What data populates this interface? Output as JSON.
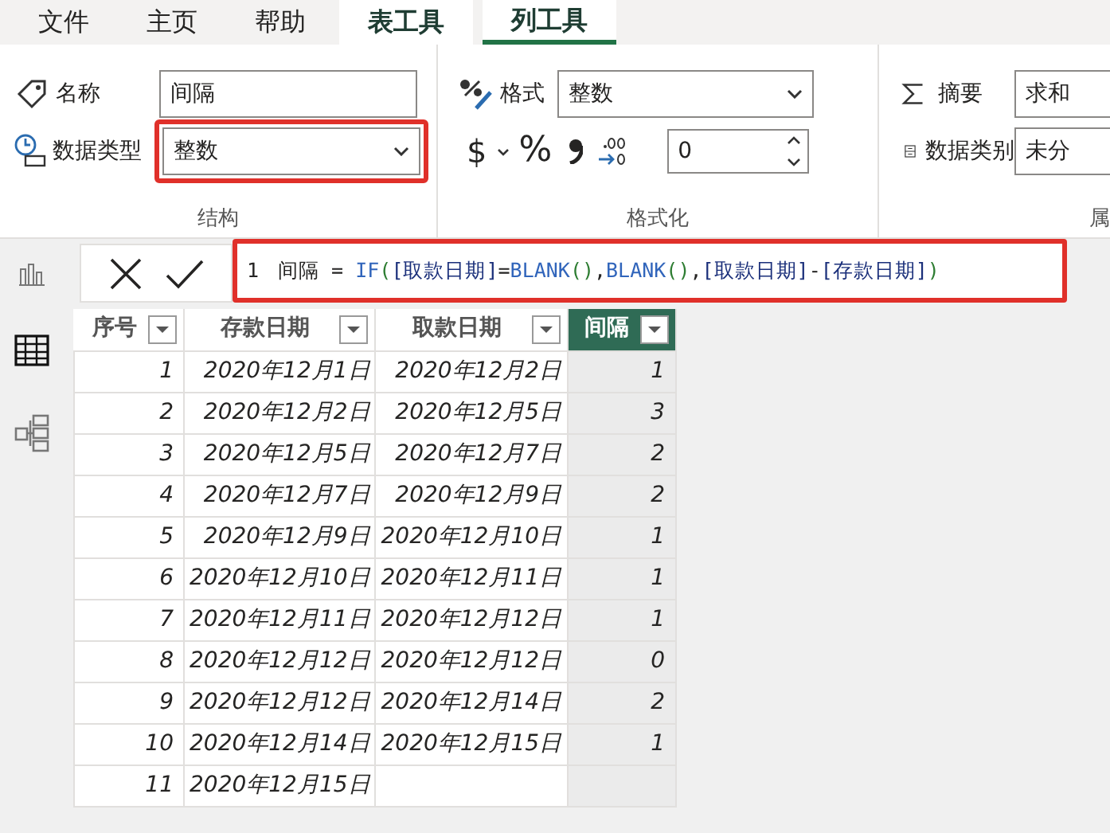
{
  "menu_tabs": [
    {
      "label": "文件",
      "kind": "plain",
      "selected": false
    },
    {
      "label": "主页",
      "kind": "plain",
      "selected": false
    },
    {
      "label": "帮助",
      "kind": "plain",
      "selected": false
    },
    {
      "label": "表工具",
      "kind": "context",
      "selected": false
    },
    {
      "label": "列工具",
      "kind": "context",
      "selected": true
    }
  ],
  "structure": {
    "name_label": "名称",
    "name_value": "间隔",
    "type_label": "数据类型",
    "type_value": "整数",
    "type_highlighted": true,
    "group_label": "结构"
  },
  "formatting": {
    "format_label": "格式",
    "format_value": "整数",
    "currency": "$",
    "percent": "%",
    "decimals_value": "0",
    "group_label": "格式化"
  },
  "properties": {
    "summary_label": "摘要",
    "summary_value": "求和",
    "category_label": "数据类别",
    "category_value": "未分",
    "group_label": "属"
  },
  "views": [
    {
      "kind": "report",
      "selected": false
    },
    {
      "kind": "table",
      "selected": true
    },
    {
      "kind": "model",
      "selected": false
    }
  ],
  "formula": {
    "line_number": "1",
    "highlighted": true,
    "tokens": [
      {
        "text": "间隔 = ",
        "kind": "plain"
      },
      {
        "text": "IF",
        "kind": "function"
      },
      {
        "text": "(",
        "kind": "paren"
      },
      {
        "text": "[取款日期]",
        "kind": "column"
      },
      {
        "text": "=",
        "kind": "plain"
      },
      {
        "text": "BLANK",
        "kind": "function"
      },
      {
        "text": "()",
        "kind": "paren"
      },
      {
        "text": ",",
        "kind": "plain"
      },
      {
        "text": "BLANK",
        "kind": "function"
      },
      {
        "text": "()",
        "kind": "paren"
      },
      {
        "text": ",",
        "kind": "plain"
      },
      {
        "text": "[取款日期]",
        "kind": "column"
      },
      {
        "text": "-",
        "kind": "plain"
      },
      {
        "text": "[存款日期]",
        "kind": "column"
      },
      {
        "text": ")",
        "kind": "paren"
      }
    ]
  },
  "table": {
    "columns": [
      {
        "label": "序号",
        "selected": false
      },
      {
        "label": "存款日期",
        "selected": false
      },
      {
        "label": "取款日期",
        "selected": false
      },
      {
        "label": "间隔",
        "selected": true
      }
    ],
    "rows": [
      [
        "1",
        "2020年12月1日",
        "2020年12月2日",
        "1"
      ],
      [
        "2",
        "2020年12月2日",
        "2020年12月5日",
        "3"
      ],
      [
        "3",
        "2020年12月5日",
        "2020年12月7日",
        "2"
      ],
      [
        "4",
        "2020年12月7日",
        "2020年12月9日",
        "2"
      ],
      [
        "5",
        "2020年12月9日",
        "2020年12月10日",
        "1"
      ],
      [
        "6",
        "2020年12月10日",
        "2020年12月11日",
        "1"
      ],
      [
        "7",
        "2020年12月11日",
        "2020年12月12日",
        "1"
      ],
      [
        "8",
        "2020年12月12日",
        "2020年12月12日",
        "0"
      ],
      [
        "9",
        "2020年12月12日",
        "2020年12月14日",
        "2"
      ],
      [
        "10",
        "2020年12月14日",
        "2020年12月15日",
        "1"
      ],
      [
        "11",
        "2020年12月15日",
        null,
        null
      ]
    ]
  }
}
